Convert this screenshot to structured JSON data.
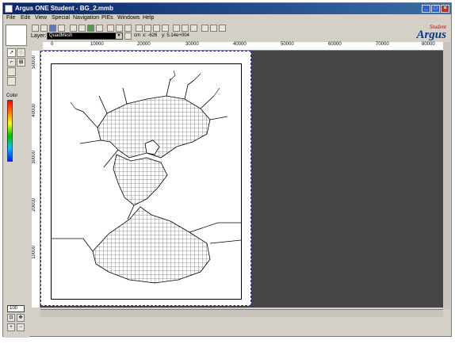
{
  "window": {
    "title": "Argus ONE Student - BG_2.mmb",
    "controls": {
      "minimize": "_",
      "maximize": "□",
      "close": "×"
    }
  },
  "menu": [
    "File",
    "Edit",
    "View",
    "Special",
    "Navigation",
    "PIEs",
    "Windows",
    "Help"
  ],
  "toolbar": {
    "layer_label": "Layer:",
    "layer_value": "QuadMesh",
    "coord_x": "x: -626",
    "coord_y": "y: 5.14e+004",
    "coord_unit": "cm"
  },
  "logo": {
    "student": "Student",
    "argus": "Argus"
  },
  "left_panel": {
    "color_label": "Color",
    "zoom_value": "100"
  },
  "rulers": {
    "top": [
      "0",
      "10000",
      "20000",
      "30000",
      "40000",
      "50000",
      "60000",
      "70000",
      "80000"
    ],
    "left": [
      "50000",
      "40000",
      "30000",
      "20000",
      "10000"
    ]
  },
  "colors": {
    "titlebar": "#0a246a",
    "canvas": "#454545",
    "accent": "#003a8c",
    "student": "#c00000"
  },
  "icons": [
    "pointer-icon",
    "lasso-icon",
    "draw-icon",
    "node-icon",
    "zoom-in-icon",
    "zoom-out-icon",
    "pan-icon"
  ]
}
